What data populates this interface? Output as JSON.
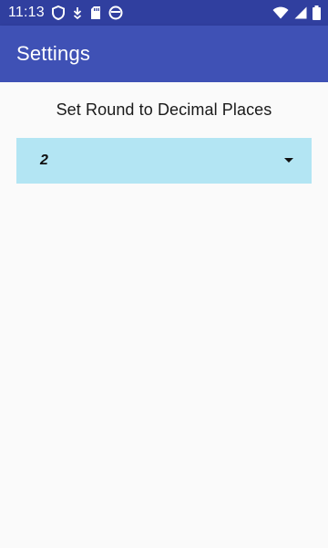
{
  "status_bar": {
    "time": "11:13",
    "left_icons": [
      "shield-icon",
      "download-arrow-icon",
      "sd-card-icon",
      "circle-notification-icon"
    ],
    "right_icons": [
      "wifi-icon",
      "cell-signal-icon",
      "battery-icon"
    ],
    "background": "#303f9f"
  },
  "app_bar": {
    "title": "Settings",
    "background": "#3f51b5"
  },
  "settings": {
    "round_label": "Set Round to Decimal Places",
    "decimal_places_selected": "2",
    "spinner_background": "#b3e5f3"
  }
}
